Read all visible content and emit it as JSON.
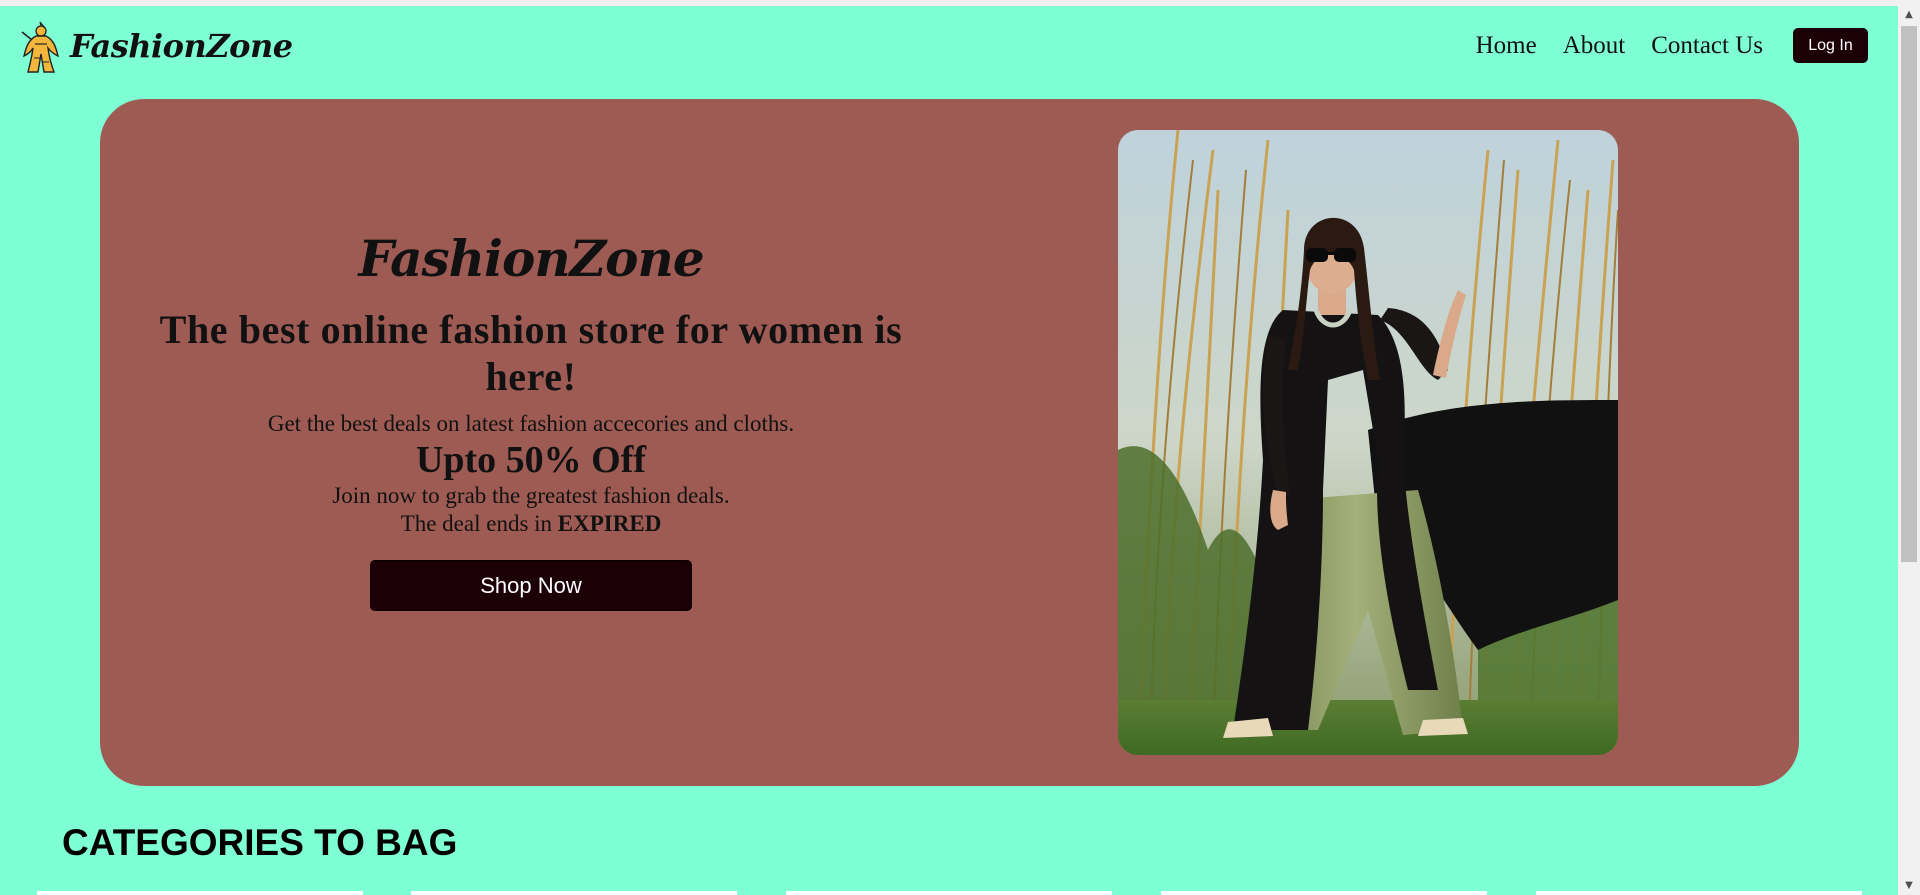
{
  "brand": {
    "name": "FashionZone",
    "logo_icon": "fashion-figure-icon"
  },
  "nav": {
    "links": [
      "Home",
      "About",
      "Contact Us"
    ],
    "login_label": "Log In"
  },
  "hero": {
    "brand": "FashionZone",
    "headline": "The best online fashion store for women is here!",
    "subtext": "Get the best deals on latest fashion accecories and cloths.",
    "offer": "Upto 50% Off",
    "join_text": "Join now to grab the greatest fashion deals.",
    "deal_prefix": "The deal ends in",
    "deal_status": "EXPIRED",
    "cta_label": "Shop Now"
  },
  "categories": {
    "heading": "CATEGORIES TO BAG"
  },
  "colors": {
    "page_background": "#7fffd4",
    "hero_background": "#9e5b53",
    "button_background": "#1c0008",
    "button_text": "#ffffff"
  }
}
